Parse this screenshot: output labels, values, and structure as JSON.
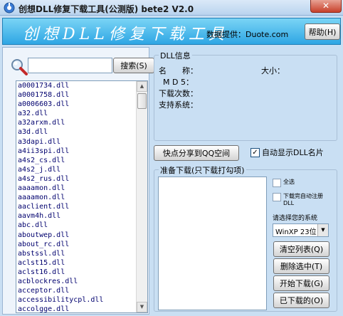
{
  "window": {
    "title": "创想DLL修复下载工具(公测版) bete2 V2.0",
    "close_glyph": "✕"
  },
  "banner": {
    "logo_text": "创想DLL修复下载工具",
    "source_text": "数据提供：Duote.com",
    "help_label": "帮助(H)"
  },
  "search": {
    "input_value": "",
    "button_label": "搜索(S)"
  },
  "file_list": {
    "items": [
      "a0001734.dll",
      "a0001758.dll",
      "a0006603.dll",
      "a32.dll",
      "a32arxm.dll",
      "a3d.dll",
      "a3dapi.dll",
      "a4ii3spi.dll",
      "a4s2_cs.dll",
      "a4s2_j.dll",
      "a4s2_rus.dll",
      "aaaamon.dll",
      "aaaamon.dll",
      "aaclient.dll",
      "aavm4h.dll",
      "abc.dll",
      "aboutwep.dll",
      "about_rc.dll",
      "abstssl.dll",
      "aclst15.dll",
      "aclst16.dll",
      "acblockres.dll",
      "acceptor.dll",
      "accessibilitycpl.dll",
      "accolgge.dll"
    ],
    "scroll_up_glyph": "▲",
    "scroll_down_glyph": "▼"
  },
  "dll_info": {
    "title": "DLL信息",
    "name_label": "名　　称：",
    "size_label": "大小：",
    "md5_label": "M D 5：",
    "downloads_label": "下载次数：",
    "systems_label": "支持系统："
  },
  "share_button_label": "快点分享到QQ空间",
  "auto_show": {
    "label": "自动显示DLL名片",
    "checked": true,
    "check_glyph": "✓"
  },
  "prepare": {
    "title": "准备下载(只下载打勾项)",
    "select_all_label": "全选",
    "auto_register_label": "下载完自动注册DLL",
    "system_select_label": "请选择您的系统",
    "system_select_value": "WinXP 23位",
    "select_arrow_glyph": "▼"
  },
  "buttons": {
    "clear_list": "清空列表(Q)",
    "delete_selected": "删除选中(T)",
    "start_download": "开始下载(G)",
    "downloaded": "已下载的(O)"
  },
  "icons": {
    "app": "app-icon",
    "search": "search-icon",
    "close": "close-icon"
  }
}
